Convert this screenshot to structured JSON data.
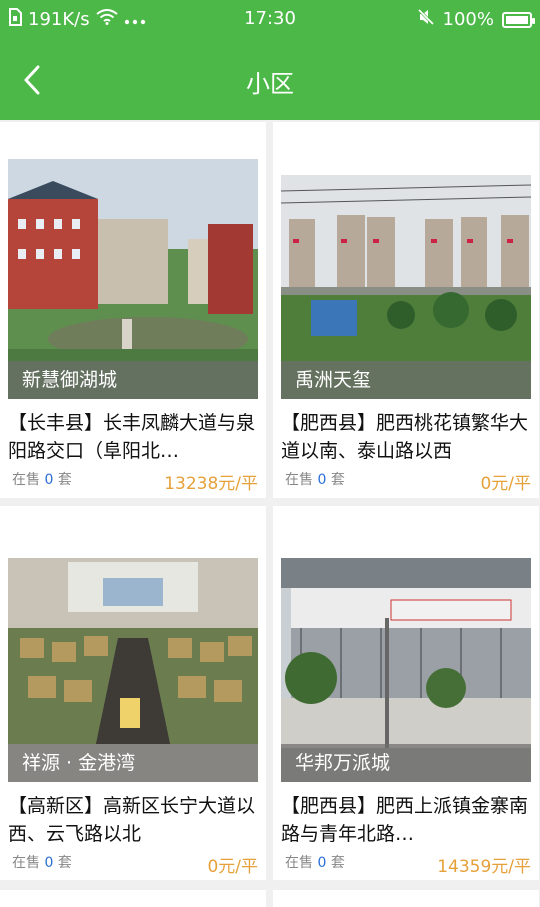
{
  "status_bar": {
    "speed": "191K/s",
    "time": "17:30",
    "battery": "100%"
  },
  "header": {
    "title": "小区"
  },
  "listings": [
    {
      "name": "新慧御湖城",
      "address": "【长丰县】长丰凤麟大道与泉阳路交口（阜阳北…",
      "sale_label": "在售",
      "sale_count": "0",
      "sale_unit": "套",
      "price": "13238元/平"
    },
    {
      "name": "禹洲天玺",
      "address": "【肥西县】肥西桃花镇繁华大道以南、泰山路以西",
      "sale_label": "在售",
      "sale_count": "0",
      "sale_unit": "套",
      "price": "0元/平"
    },
    {
      "name": "祥源 · 金港湾",
      "address": "【高新区】高新区长宁大道以西、云飞路以北",
      "sale_label": "在售",
      "sale_count": "0",
      "sale_unit": "套",
      "price": "0元/平"
    },
    {
      "name": "华邦万派城",
      "address": "【肥西县】肥西上派镇金寨南路与青年北路…",
      "sale_label": "在售",
      "sale_count": "0",
      "sale_unit": "套",
      "price": "14359元/平"
    }
  ],
  "colors": {
    "brand_green": "#4cb848",
    "price_orange": "#e6a13a",
    "count_blue": "#2a6fd6"
  }
}
